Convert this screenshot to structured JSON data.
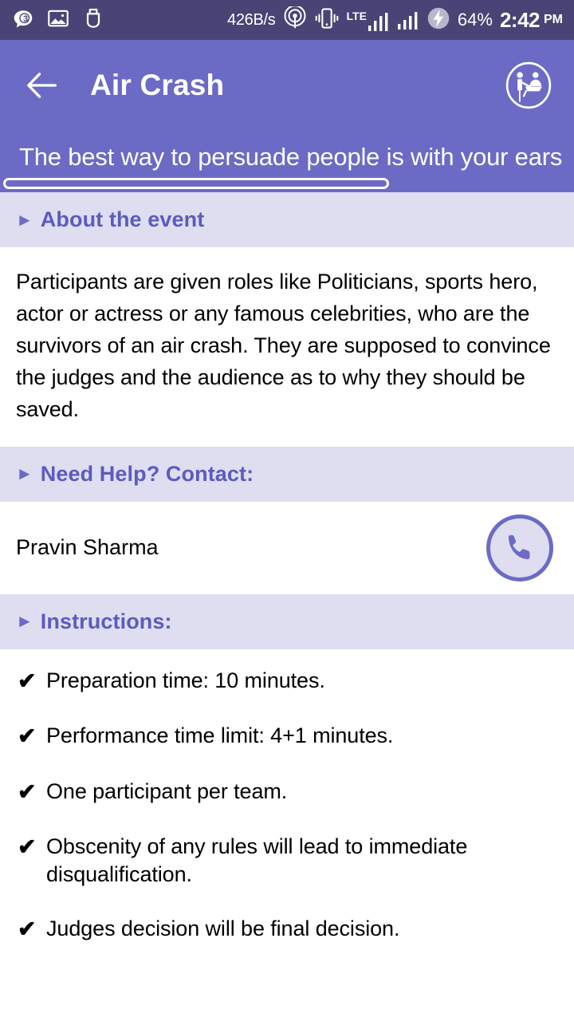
{
  "status_bar": {
    "background": "#484475",
    "notification_badge_count": "3",
    "icons_left": [
      "chat-bubble-badge-icon",
      "image-icon",
      "usb-icon"
    ],
    "network_speed": "426B/s",
    "icons_right": [
      "hotspot-icon",
      "vibrate-icon",
      "lte-signal-icon",
      "signal-bars-icon",
      "charging-bolt-icon"
    ],
    "lte_label": "LTE",
    "battery_percent": "64%",
    "time": "2:42",
    "am_pm": "PM"
  },
  "app_bar": {
    "background": "#6B6BC6",
    "back_icon": "back-arrow-icon",
    "title": "Air Crash",
    "action_icon": "presentation-people-icon"
  },
  "quote_bar": {
    "text": "The best way to persuade people is with your ears",
    "scrollbar": "horizontal-scrollbar"
  },
  "sections": {
    "about": {
      "marker": "►",
      "title": "About the event",
      "paragraph": "Participants are given roles like Politicians, sports hero, actor or actress or any famous celebrities, who are the survivors of an air crash. They are supposed to convince the judges and the audience as to why they should be saved."
    },
    "contact": {
      "marker": "►",
      "title": "Need Help? Contact:",
      "name": "Pravin Sharma",
      "call_icon": "phone-call-icon"
    },
    "instructions": {
      "marker": "►",
      "title": "Instructions:",
      "check": "✔",
      "items": [
        "Preparation time: 10 minutes.",
        "Performance time limit: 4+1 minutes.",
        "One participant per team.",
        "Obscenity of any rules will lead to immediate disqualification.",
        "Judges decision will be final decision."
      ]
    }
  },
  "colors": {
    "status_bar": "#484475",
    "primary": "#6B6BC6",
    "section_header_bg": "#DEDEF0",
    "section_title_text": "#5B5BC0",
    "body_text": "#000000"
  }
}
